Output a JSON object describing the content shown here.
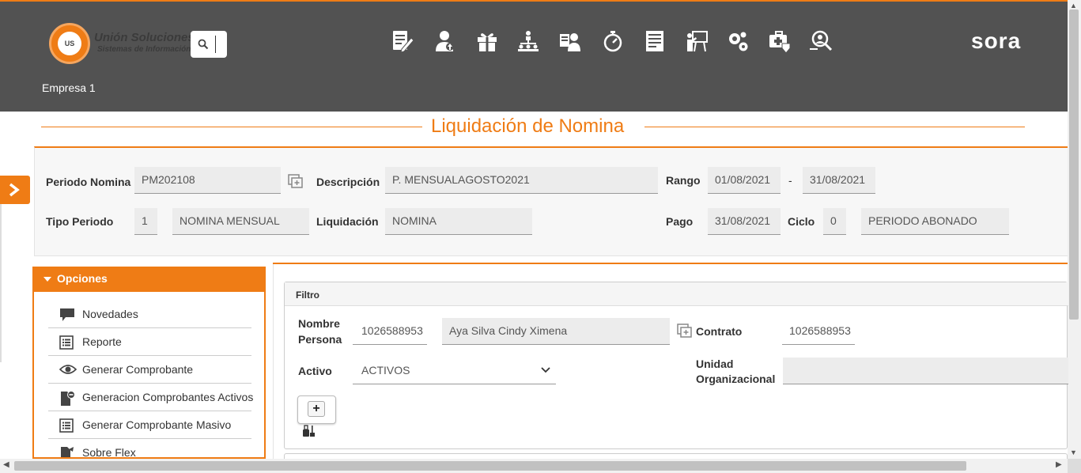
{
  "header": {
    "brand_name": "Unión Soluciones",
    "brand_sub": "Sistemas de Información",
    "logo_text": "US",
    "company": "Empresa 1",
    "product_name": "sora",
    "nav_icons": [
      "edit-document-icon",
      "user-upload-icon",
      "gift-icon",
      "org-hierarchy-icon",
      "employee-card-icon",
      "stopwatch-icon",
      "form-document-icon",
      "presentation-icon",
      "gears-icon",
      "medical-kit-icon",
      "user-search-icon"
    ]
  },
  "page": {
    "title": "Liquidación de Nomina"
  },
  "summary": {
    "periodo_label": "Periodo Nomina",
    "periodo_value": "PM202108",
    "descripcion_label": "Descripción",
    "descripcion_value": "P. MENSUALAGOSTO2021",
    "rango_label": "Rango",
    "rango_from": "01/08/2021",
    "rango_sep": "-",
    "rango_to": "31/08/2021",
    "tipo_label": "Tipo Periodo",
    "tipo_code": "1",
    "tipo_value": "NOMINA MENSUAL",
    "liquidacion_label": "Liquidación",
    "liquidacion_value": "NOMINA",
    "pago_label": "Pago",
    "pago_value": "31/08/2021",
    "ciclo_label": "Ciclo",
    "ciclo_code": "0",
    "ciclo_value": "PERIODO ABONADO"
  },
  "menu": {
    "title": "Opciones",
    "items": [
      {
        "label": "Novedades",
        "icon": "comment-icon"
      },
      {
        "label": "Reporte",
        "icon": "list-icon"
      },
      {
        "label": "Generar Comprobante",
        "icon": "eye-icon"
      },
      {
        "label": "Generacion Comprobantes Activos",
        "icon": "document-minus-icon"
      },
      {
        "label": "Generar Comprobante Masivo",
        "icon": "list-icon"
      },
      {
        "label": "Sobre Flex",
        "icon": "document-share-icon"
      }
    ]
  },
  "filtro": {
    "title": "Filtro",
    "nombre_label_1": "Nombre",
    "nombre_label_2": "Persona",
    "persona_id": "1026588953",
    "persona_name": "Aya Silva Cindy Ximena",
    "contrato_label": "Contrato",
    "contrato_value": "1026588953",
    "activo_label": "Activo",
    "activo_value": "ACTIVOS",
    "unidad_label_1": "Unidad",
    "unidad_label_2": "Organizacional",
    "unidad_value": "",
    "add_label": "+"
  },
  "colors": {
    "accent": "#ef7c15",
    "header_bg": "#525252",
    "field_bg": "#ececec"
  }
}
